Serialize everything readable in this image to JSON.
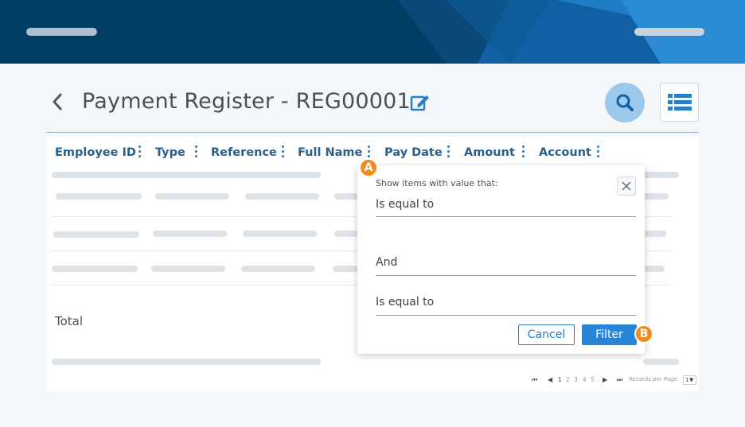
{
  "header": {
    "title": "Payment Register - REG00001"
  },
  "table": {
    "columns": [
      "Employee ID",
      "Type",
      "Reference",
      "Full Name",
      "Pay Date",
      "Amount",
      "Account"
    ],
    "total_label": "Total"
  },
  "filter_popup": {
    "instruction": "Show items with value that:",
    "operator_1": "Is equal to",
    "logic": "And",
    "operator_2": "Is equal to",
    "cancel_label": "Cancel",
    "filter_label": "Filter"
  },
  "markers": {
    "a": "A",
    "b": "B"
  },
  "pager": {
    "pages": [
      "1",
      "2",
      "3",
      "4",
      "5"
    ],
    "records_label": "Records per Page",
    "records_value": "1"
  },
  "colors": {
    "banner": "#003e68",
    "accent": "#2685d6",
    "header_text": "#2a5f8a",
    "marker": "#f28a1d"
  }
}
